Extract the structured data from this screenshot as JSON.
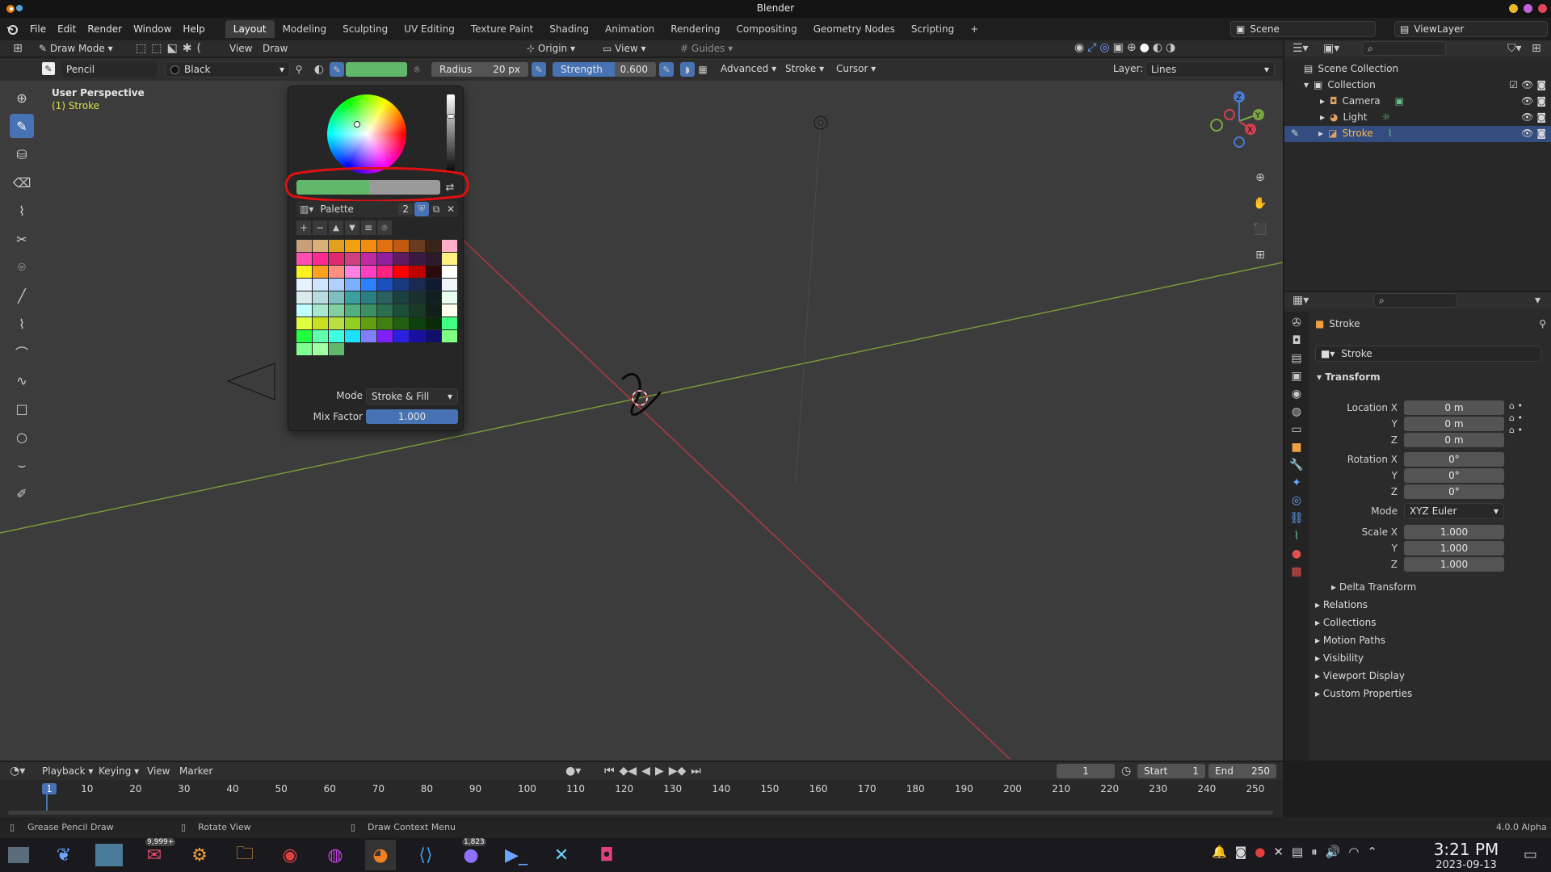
{
  "app": {
    "title": "Blender",
    "version": "4.0.0 Alpha"
  },
  "menu": [
    "File",
    "Edit",
    "Render",
    "Window",
    "Help"
  ],
  "workspaces": [
    "Layout",
    "Modeling",
    "Sculpting",
    "UV Editing",
    "Texture Paint",
    "Shading",
    "Animation",
    "Rendering",
    "Compositing",
    "Geometry Nodes",
    "Scripting"
  ],
  "active_workspace": "Layout",
  "scene": {
    "label": "Scene",
    "viewlayer": "ViewLayer"
  },
  "viewport_header": {
    "mode": "Draw Mode",
    "view": "View",
    "draw": "Draw",
    "origin": "Origin",
    "view2": "View",
    "guides": "Guides"
  },
  "tool_settings": {
    "brush": "Pencil",
    "material": "Black",
    "radius_label": "Radius",
    "radius_value": "20 px",
    "strength_label": "Strength",
    "strength_value": "0.600",
    "advanced": "Advanced",
    "stroke": "Stroke",
    "cursor": "Cursor",
    "layer_label": "Layer:",
    "layer_value": "Lines",
    "color_active": "#62b86a"
  },
  "viewport": {
    "perspective": "User Perspective",
    "object": "(1) Stroke"
  },
  "color_popup": {
    "palette_label": "Palette",
    "palette_users": "2",
    "mode_label": "Mode",
    "mode_value": "Stroke & Fill",
    "mix_label": "Mix Factor",
    "mix_value": "1.000",
    "color_primary": "#62b86a",
    "color_secondary": "#9a9a9a"
  },
  "palette_colors": [
    "#c8a07a",
    "#d9b07a",
    "#e0a020",
    "#f0a010",
    "#f08c10",
    "#e07010",
    "#c05a10",
    "#6a3a20",
    "#3a2418",
    "#ffb0c8",
    "#ff4fb0",
    "#ff2a90",
    "#e02a70",
    "#d04080",
    "#c02aa0",
    "#9020a0",
    "#601a60",
    "#3a1a40",
    "#2a1a2a",
    "#ffef80",
    "#fff020",
    "#ffa020",
    "#ff9080",
    "#ff80e0",
    "#ff40c0",
    "#ff2080",
    "#ff0000",
    "#c00000",
    "#2a0a0a",
    "#ffffff",
    "#e6f2ff",
    "#cfe4ff",
    "#b0d0ff",
    "#7ab0ff",
    "#2a80ff",
    "#1a50c0",
    "#1a3a80",
    "#1a2a50",
    "#101a30",
    "#eef4f8",
    "#d8ecef",
    "#b8dce0",
    "#80c0c0",
    "#3aa0a0",
    "#2a8080",
    "#2a6060",
    "#1a4040",
    "#1a3030",
    "#102020",
    "#e8fff0",
    "#c0ffff",
    "#a8e8d0",
    "#80d0a0",
    "#50b080",
    "#3a9060",
    "#2a7050",
    "#1a5038",
    "#1a3a28",
    "#102018",
    "#fffff0",
    "#e0ff40",
    "#c8e020",
    "#b8e040",
    "#90d020",
    "#60a010",
    "#408010",
    "#206010",
    "#104010",
    "#0a2a0a",
    "#40ff80",
    "#20ff40",
    "#60ffb0",
    "#40ffe0",
    "#20e0ff",
    "#8080ff",
    "#8020ff",
    "#2a20e0",
    "#1a10a0",
    "#10106a",
    "#80ff80",
    "#80ff90",
    "#a0ffa0",
    "#62b86a"
  ],
  "outliner": {
    "scene_collection": "Scene Collection",
    "collection": "Collection",
    "items": [
      "Camera",
      "Light",
      "Stroke"
    ]
  },
  "properties": {
    "object_name": "Stroke",
    "data_name": "Stroke",
    "transform": "Transform",
    "location_label": "Location X",
    "rotation_label": "Rotation X",
    "mode_label": "Mode",
    "scale_label": "Scale X",
    "y": "Y",
    "z": "Z",
    "loc": [
      "0 m",
      "0 m",
      "0 m"
    ],
    "rot": [
      "0°",
      "0°",
      "0°"
    ],
    "rot_mode": "XYZ Euler",
    "scale": [
      "1.000",
      "1.000",
      "1.000"
    ],
    "delta": "Delta Transform",
    "sections": [
      "Relations",
      "Collections",
      "Motion Paths",
      "Visibility",
      "Viewport Display",
      "Custom Properties"
    ]
  },
  "timeline": {
    "playback": "Playback",
    "keying": "Keying",
    "view": "View",
    "marker": "Marker",
    "current": "1",
    "start_label": "Start",
    "start": "1",
    "end_label": "End",
    "end": "250",
    "ticks": [
      "1",
      "10",
      "20",
      "30",
      "40",
      "50",
      "60",
      "70",
      "80",
      "90",
      "100",
      "110",
      "120",
      "130",
      "140",
      "150",
      "160",
      "170",
      "180",
      "190",
      "200",
      "210",
      "220",
      "230",
      "240",
      "250"
    ]
  },
  "statusbar": {
    "left": "Grease Pencil Draw",
    "mid": "Rotate View",
    "right": "Draw Context Menu"
  },
  "taskbar": {
    "mail_badge": "9,999+",
    "chat_badge": "1,823",
    "time": "3:21 PM",
    "date": "2023-09-13"
  }
}
